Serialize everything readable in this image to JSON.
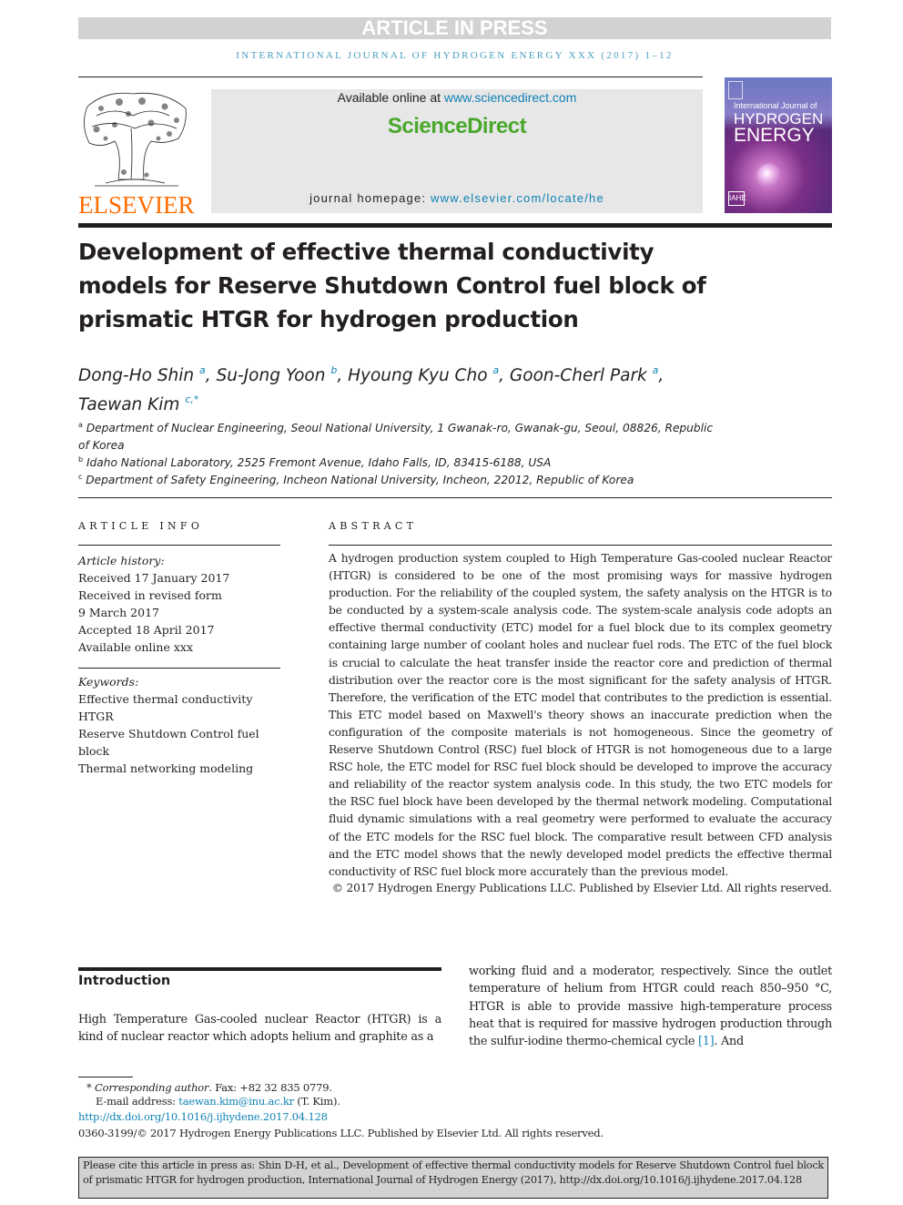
{
  "banner": {
    "label": "ARTICLE IN PRESS"
  },
  "journal_line": "INTERNATIONAL JOURNAL OF HYDROGEN ENERGY XXX (2017) 1–12",
  "publisher": {
    "logo_text": "ELSEVIER"
  },
  "sciencedirect": {
    "available_prefix": "Available online at ",
    "available_link": "www.sciencedirect.com",
    "logo_text": "ScienceDirect",
    "homepage_prefix": "journal homepage: ",
    "homepage_link": "www.elsevier.com/locate/he"
  },
  "cover": {
    "line1": "International Journal of",
    "line2": "HYDROGEN",
    "line3": "ENERGY",
    "badge": "IAHE"
  },
  "article": {
    "title": "Development of effective thermal conductivity models for Reserve Shutdown Control fuel block of prismatic HTGR for hydrogen production",
    "authors": [
      {
        "name": "Dong-Ho Shin",
        "sup": "a"
      },
      {
        "name": "Su-Jong Yoon",
        "sup": "b"
      },
      {
        "name": "Hyoung Kyu Cho",
        "sup": "a"
      },
      {
        "name": "Goon-Cherl Park",
        "sup": "a"
      },
      {
        "name": "Taewan Kim",
        "sup": "c,*"
      }
    ],
    "affiliations": [
      {
        "key": "a",
        "text": "Department of Nuclear Engineering, Seoul National University, 1 Gwanak-ro, Gwanak-gu, Seoul, 08826, Republic",
        "cont": "of Korea"
      },
      {
        "key": "b",
        "text": "Idaho National Laboratory, 2525 Fremont Avenue, Idaho Falls, ID, 83415-6188, USA"
      },
      {
        "key": "c",
        "text": "Department of Safety Engineering, Incheon National University, Incheon, 22012, Republic of Korea"
      }
    ]
  },
  "article_info": {
    "heading": "ARTICLE INFO",
    "history_label": "Article history:",
    "history": [
      "Received 17 January 2017",
      "Received in revised form",
      "9 March 2017",
      "Accepted 18 April 2017",
      "Available online xxx"
    ],
    "keywords_label": "Keywords:",
    "keywords": [
      "Effective thermal conductivity",
      "HTGR",
      "Reserve Shutdown Control fuel",
      "block",
      "Thermal networking modeling"
    ]
  },
  "abstract": {
    "heading": "ABSTRACT",
    "text": "A hydrogen production system coupled to High Temperature Gas-cooled nuclear Reactor (HTGR) is considered to be one of the most promising ways for massive hydrogen production. For the reliability of the coupled system, the safety analysis on the HTGR is to be conducted by a system-scale analysis code. The system-scale analysis code adopts an effective thermal conductivity (ETC) model for a fuel block due to its complex geometry containing large number of coolant holes and nuclear fuel rods. The ETC of the fuel block is crucial to calculate the heat transfer inside the reactor core and prediction of thermal distribution over the reactor core is the most significant for the safety analysis of HTGR. Therefore, the verification of the ETC model that contributes to the prediction is essential. This ETC model based on Maxwell's theory shows an inaccurate prediction when the configuration of the composite materials is not homogeneous. Since the geometry of Reserve Shutdown Control (RSC) fuel block of HTGR is not homogeneous due to a large RSC hole, the ETC model for RSC fuel block should be developed to improve the accuracy and reliability of the reactor system analysis code. In this study, the two ETC models for the RSC fuel block have been developed by the thermal network modeling. Computational fluid dynamic simulations with a real geometry were performed to evaluate the accuracy of the ETC models for the RSC fuel block. The comparative result between CFD analysis and the ETC model shows that the newly developed model predicts the effective thermal conductivity of RSC fuel block more accurately than the previous model.",
    "copyright": "© 2017 Hydrogen Energy Publications LLC. Published by Elsevier Ltd. All rights reserved."
  },
  "introduction": {
    "heading": "Introduction",
    "left_text": "High Temperature Gas-cooled nuclear Reactor (HTGR) is a kind of nuclear reactor which adopts helium and graphite as a",
    "right_text": "working fluid and a moderator, respectively. Since the outlet temperature of helium from HTGR could reach 850–950 °C, HTGR is able to provide massive high-temperature process heat that is required for massive hydrogen production through the sulfur-iodine thermo-chemical cycle ",
    "right_ref": "[1]",
    "right_tail": ". And"
  },
  "footnotes": {
    "corresponding_star": "*",
    "corresponding_label": "Corresponding author",
    "corresponding_rest": ". Fax: +82 32 835 0779.",
    "email_label": "E-mail address: ",
    "email": "taewan.kim@inu.ac.kr",
    "email_tail": " (T. Kim).",
    "doi": "http://dx.doi.org/10.1016/j.ijhydene.2017.04.128",
    "issn_line": "0360-3199/© 2017 Hydrogen Energy Publications LLC. Published by Elsevier Ltd. All rights reserved."
  },
  "citation_box": {
    "text": "Please cite this article in press as: Shin D-H, et al., Development of effective thermal conductivity models for Reserve Shutdown Control fuel block of prismatic HTGR for hydrogen production, International Journal of Hydrogen Energy (2017), http://dx.doi.org/10.1016/j.ijhydene.2017.04.128"
  },
  "colors": {
    "link": "#0f82b4",
    "sciencedirect_green": "#4aa82c",
    "elsevier_orange": "#ff6c00",
    "banner_gray": "#d1d2d4"
  }
}
